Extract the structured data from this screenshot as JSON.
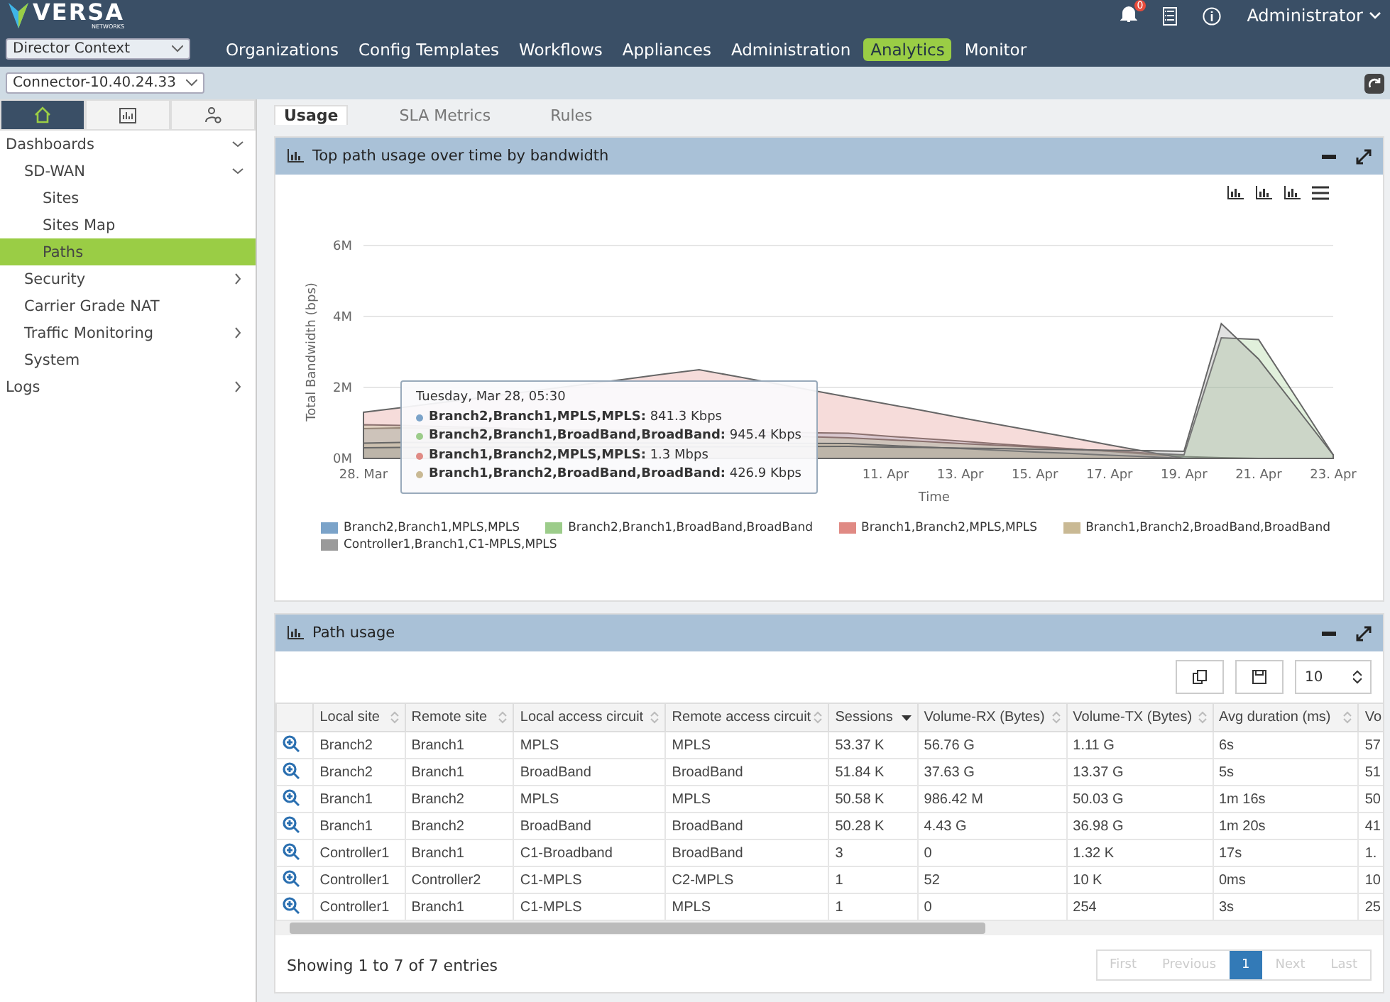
{
  "header": {
    "logo": "VERSA",
    "logo_sub": "NETWORKS",
    "notification_count": "0",
    "user": "Administrator",
    "context_select": "Director Context",
    "nav": [
      {
        "label": "Organizations",
        "selected": false
      },
      {
        "label": "Config Templates",
        "selected": false
      },
      {
        "label": "Workflows",
        "selected": false
      },
      {
        "label": "Appliances",
        "selected": false
      },
      {
        "label": "Administration",
        "selected": false
      },
      {
        "label": "Analytics",
        "selected": true
      },
      {
        "label": "Monitor",
        "selected": false
      }
    ],
    "connector_select": "Connector-10.40.24.33"
  },
  "sidebar": {
    "tabs": [
      {
        "kind": "home",
        "selected": true
      },
      {
        "kind": "chart",
        "selected": false
      },
      {
        "kind": "admin",
        "selected": false
      }
    ],
    "items": [
      {
        "label": "Dashboards",
        "expanded": true,
        "selected": false,
        "children": [
          {
            "label": "SD-WAN",
            "expanded": true,
            "selected": false,
            "children": [
              {
                "label": "Sites",
                "selected": false
              },
              {
                "label": "Sites Map",
                "selected": false
              },
              {
                "label": "Paths",
                "selected": true
              }
            ]
          },
          {
            "label": "Security",
            "expanded": false,
            "selected": false
          },
          {
            "label": "Carrier Grade NAT",
            "selected": false
          },
          {
            "label": "Traffic Monitoring",
            "expanded": false,
            "selected": false
          },
          {
            "label": "System",
            "selected": false
          }
        ]
      },
      {
        "label": "Logs",
        "expanded": false,
        "selected": false
      }
    ]
  },
  "content_tabs": [
    {
      "label": "Usage",
      "selected": true
    },
    {
      "label": "SLA Metrics",
      "selected": false
    },
    {
      "label": "Rules",
      "selected": false
    }
  ],
  "chart_panel": {
    "title": "Top path usage over time by bandwidth",
    "chart_data": {
      "type": "area",
      "xlabel": "Time",
      "ylabel": "Total Bandwidth (bps)",
      "categories": [
        "28. Mar",
        null,
        null,
        null,
        null,
        null,
        null,
        null,
        null,
        null,
        null,
        null,
        null,
        null,
        "11. Apr",
        null,
        "13. Apr",
        null,
        "15. Apr",
        null,
        "17. Apr",
        null,
        "19. Apr",
        null,
        "21. Apr",
        null,
        "23. Apr"
      ],
      "yticks": [
        {
          "value": 0,
          "label": "0M"
        },
        {
          "value": 2,
          "label": "2M"
        },
        {
          "value": 4,
          "label": "4M"
        },
        {
          "value": 6,
          "label": "6M"
        }
      ],
      "ylim": [
        0,
        6
      ],
      "series": [
        {
          "name": "Branch2,Branch1,MPLS,MPLS",
          "color": "#7ba3c9",
          "values": [
            0.84,
            0.86,
            null,
            null,
            null,
            null,
            null,
            null,
            null,
            null,
            null,
            null,
            null,
            0.71,
            0.63,
            0.56,
            0.49,
            0.41,
            0.34,
            0.27,
            0.2,
            0.12,
            0.05,
            0.02,
            0,
            0,
            0
          ]
        },
        {
          "name": "Branch2,Branch1,BroadBand,BroadBand",
          "color": "#9ccc8a",
          "values": [
            0.95,
            0.93,
            null,
            null,
            null,
            null,
            null,
            null,
            null,
            null,
            null,
            null,
            null,
            0.58,
            0.53,
            0.48,
            0.42,
            0.37,
            0.32,
            0.26,
            0.21,
            0.15,
            0.1,
            3.4,
            3.35,
            1.73,
            0.1
          ]
        },
        {
          "name": "Branch1,Branch2,MPLS,MPLS",
          "color": "#e08a84",
          "values": [
            1.3,
            1.43,
            null,
            null,
            null,
            null,
            null,
            2.23,
            2.37,
            2.5,
            2.31,
            null,
            null,
            1.73,
            1.54,
            1.35,
            1.15,
            0.96,
            0.77,
            0.58,
            0.38,
            0.19,
            0,
            0,
            0,
            0,
            0
          ]
        },
        {
          "name": "Branch1,Branch2,BroadBand,BroadBand",
          "color": "#c9b994",
          "values": [
            0.43,
            0.45,
            null,
            null,
            null,
            null,
            null,
            null,
            null,
            null,
            null,
            null,
            null,
            0.42,
            0.37,
            0.32,
            0.28,
            0.23,
            0.18,
            0.14,
            0.09,
            0.05,
            0,
            0,
            0,
            0,
            0
          ]
        },
        {
          "name": "Controller1,Branch1,C1-MPLS,MPLS",
          "color": "#9a9a9a",
          "values": [
            0.3,
            0.31,
            null,
            null,
            null,
            null,
            null,
            null,
            null,
            null,
            null,
            null,
            null,
            0.34,
            0.32,
            0.31,
            0.29,
            0.28,
            0.26,
            0.25,
            0.23,
            0.22,
            0.2,
            3.8,
            2.8,
            1.45,
            0.1
          ]
        }
      ]
    },
    "tooltip": {
      "title": "Tuesday, Mar 28, 05:30",
      "lines": [
        "**Branch2,Branch1,MPLS,MPLS:** 841.3 Kbps",
        "**Branch2,Branch1,BroadBand,BroadBand:** 945.4 Kbps",
        "**Branch1,Branch2,MPLS,MPLS:** 1.3 Mbps",
        "**Branch1,Branch2,BroadBand,BroadBand:** 426.9 Kbps"
      ]
    }
  },
  "table_panel": {
    "title": "Path usage",
    "page_size": "10",
    "columns": [
      {
        "label": "Local site",
        "sorted": false
      },
      {
        "label": "Remote site",
        "sorted": false
      },
      {
        "label": "Local access circuit",
        "sorted": false
      },
      {
        "label": "Remote access circuit",
        "sorted": false
      },
      {
        "label": "Sessions",
        "sorted": true
      },
      {
        "label": "Volume-RX (Bytes)",
        "sorted": false
      },
      {
        "label": "Volume-TX (Bytes)",
        "sorted": false
      },
      {
        "label": "Avg duration (ms)",
        "sorted": false
      },
      {
        "label": "Vo"
      }
    ],
    "rows": [
      [
        "Branch2",
        "Branch1",
        "MPLS",
        "MPLS",
        "53.37 K",
        "56.76 G",
        "1.11 G",
        "6s",
        "57"
      ],
      [
        "Branch2",
        "Branch1",
        "BroadBand",
        "BroadBand",
        "51.84 K",
        "37.63 G",
        "13.37 G",
        "5s",
        "51"
      ],
      [
        "Branch1",
        "Branch2",
        "MPLS",
        "MPLS",
        "50.58 K",
        "986.42 M",
        "50.03 G",
        "1m 16s",
        "50"
      ],
      [
        "Branch1",
        "Branch2",
        "BroadBand",
        "BroadBand",
        "50.28 K",
        "4.43 G",
        "36.98 G",
        "1m 20s",
        "41"
      ],
      [
        "Controller1",
        "Branch1",
        "C1-Broadband",
        "BroadBand",
        "3",
        "0",
        "1.32 K",
        "17s",
        "1."
      ],
      [
        "Controller1",
        "Controller2",
        "C1-MPLS",
        "C2-MPLS",
        "1",
        "52",
        "10 K",
        "0ms",
        "10"
      ],
      [
        "Controller1",
        "Branch1",
        "C1-MPLS",
        "MPLS",
        "1",
        "0",
        "254",
        "3s",
        "25"
      ]
    ],
    "footer": "Showing 1 to 7 of 7 entries",
    "pagination": [
      {
        "label": "First",
        "selected": false,
        "disabled": true
      },
      {
        "label": "Previous",
        "selected": false,
        "disabled": true
      },
      {
        "label": "1",
        "selected": true,
        "disabled": false
      },
      {
        "label": "Next",
        "selected": false,
        "disabled": true
      },
      {
        "label": "Last",
        "selected": false,
        "disabled": true
      }
    ]
  }
}
